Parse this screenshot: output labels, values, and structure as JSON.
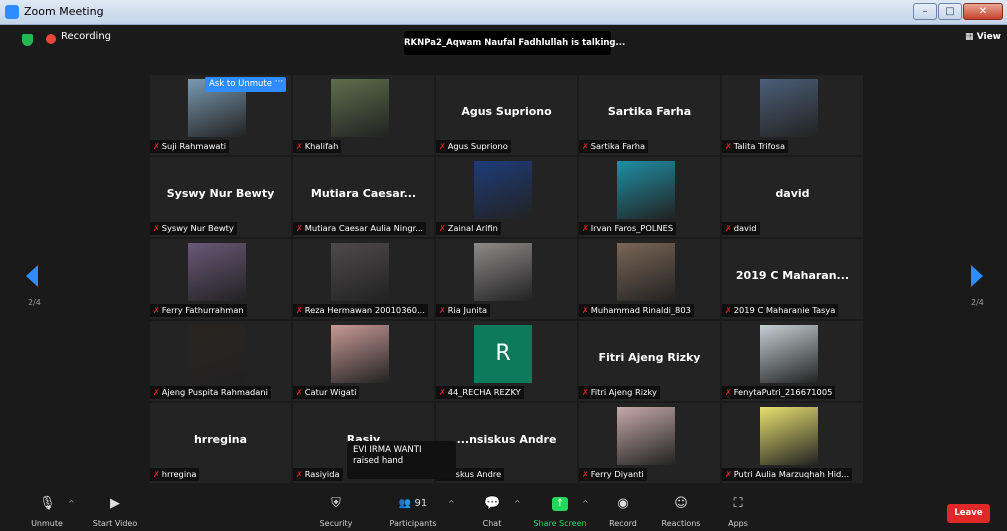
{
  "window": {
    "title": "Zoom Meeting"
  },
  "topbar": {
    "recording": "Recording",
    "talking": "RKNPa2_Aqwam Naufal Fadhlullah is talking...",
    "view": "View"
  },
  "ask_to_unmute": {
    "label": "Ask to Unmute",
    "more": "···"
  },
  "pages": {
    "left": "2/4",
    "right": "2/4"
  },
  "tiles": [
    {
      "name": "Suji Rahmawati",
      "photo": "#7a9ab2"
    },
    {
      "name": "Khalifah",
      "photo": "#5d6f4c"
    },
    {
      "name": "Agus Supriono",
      "big": "Agus Supriono"
    },
    {
      "name": "Sartika Farha",
      "big": "Sartika Farha"
    },
    {
      "name": "Talita Trifosa",
      "photo": "#4b5f78"
    },
    {
      "name": "Syswy Nur Bewty",
      "big": "Syswy Nur Bewty"
    },
    {
      "name": "Mutiara Caesar Aulia Ningr...",
      "big": "Mutiara  Caesar..."
    },
    {
      "name": "Zainal Arifin",
      "photo": "#1e3c7a"
    },
    {
      "name": "Irvan Faros_POLNES",
      "photo": "#1f8fa5"
    },
    {
      "name": "david",
      "big": "david"
    },
    {
      "name": "Ferry Fathurrahman",
      "photo": "#6a5878"
    },
    {
      "name": "Reza Hermawan 20010360...",
      "photo": "#4e4a4c"
    },
    {
      "name": "Ria Junita",
      "photo": "#8e8a8a"
    },
    {
      "name": "Muhammad Rinaldi_803",
      "photo": "#7a6656"
    },
    {
      "name": "2019 C Maharanie Tasya",
      "big": "2019 C Maharan..."
    },
    {
      "name": "Ajeng Puspita Rahmadani",
      "photo": "#2a2420"
    },
    {
      "name": "Catur Wigati",
      "photo": "#c89a96"
    },
    {
      "name": "44_RECHA REZKY",
      "letter": "R",
      "letter_bg": "#0d7a5c"
    },
    {
      "name": "Fitri Ajeng Rizky",
      "big": "Fitri Ajeng Rizky"
    },
    {
      "name": "FenytaPutri_216671005",
      "photo": "#c4d0d4"
    },
    {
      "name": "hrregina",
      "big": "hrregina"
    },
    {
      "name": "Rasiyida",
      "big": "Rasiy"
    },
    {
      "name": "...skus Andre",
      "big": "...nsiskus Andre"
    },
    {
      "name": "Ferry Diyanti",
      "photo": "#c5a9a8"
    },
    {
      "name": "Putri Aulia Marzuqhah Hid...",
      "photo": "#e8e070"
    }
  ],
  "tooltip": {
    "text": "EVI IRMA WANTI raised hand"
  },
  "toolbar": {
    "unmute": "Unmute",
    "start_video": "Start Video",
    "security": "Security",
    "participants": "Participants",
    "participants_count": "91",
    "chat": "Chat",
    "share_screen": "Share Screen",
    "record": "Record",
    "reactions": "Reactions",
    "apps": "Apps",
    "leave": "Leave"
  },
  "colors": {
    "accent": "#2d8cff",
    "leave": "#e02828",
    "share": "#23d959",
    "muted": "#e02424"
  }
}
